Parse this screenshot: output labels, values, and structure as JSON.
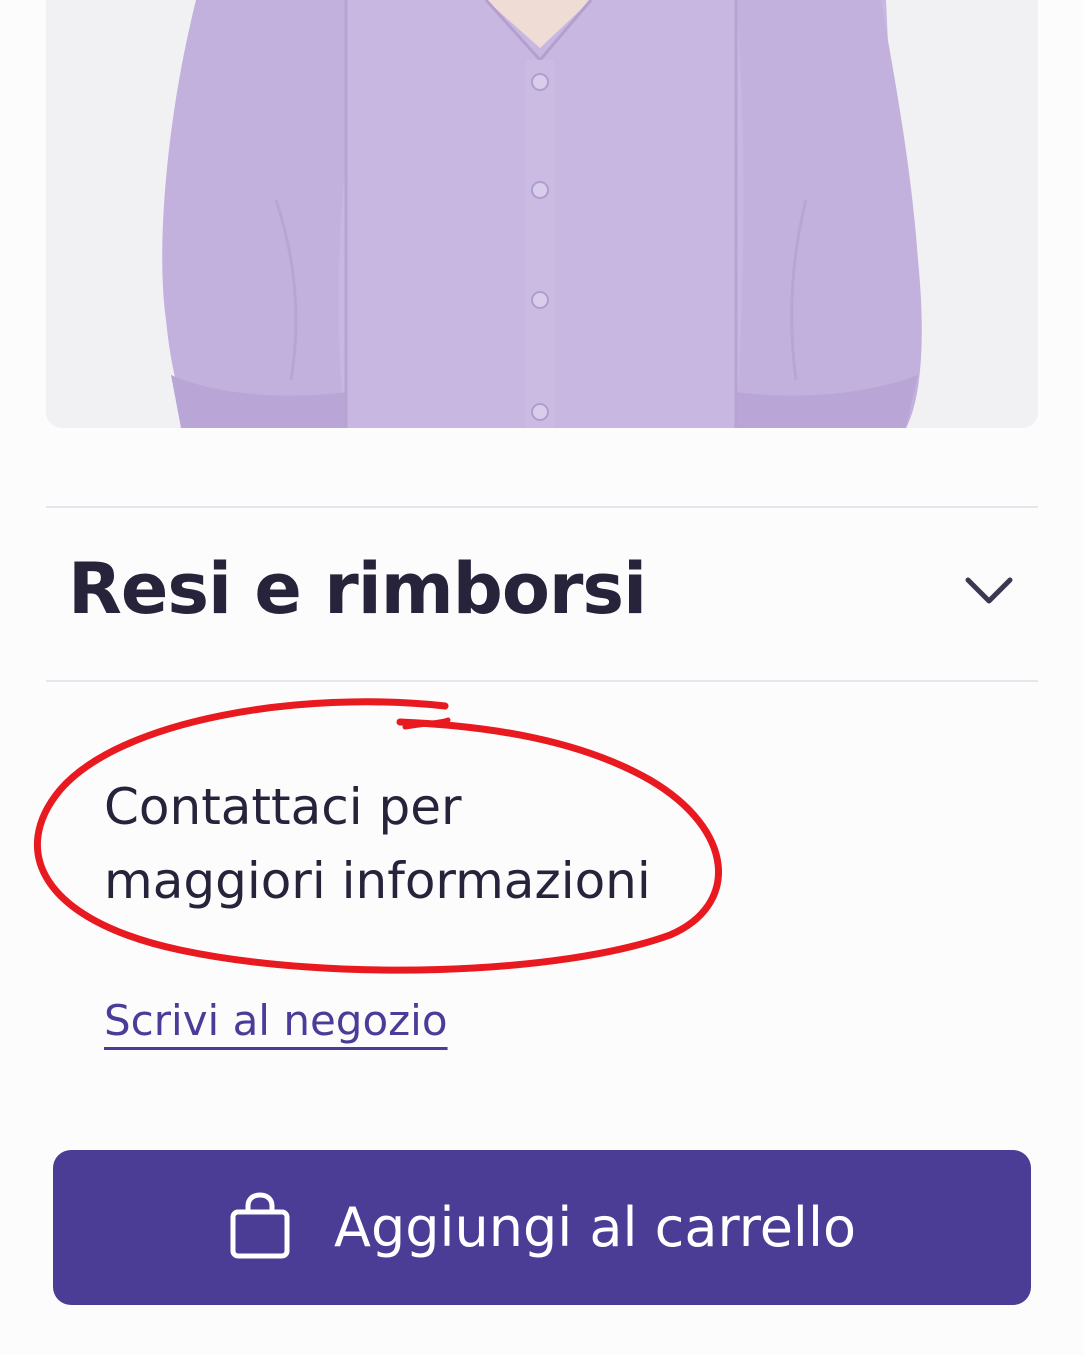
{
  "product": {
    "image_subject": "lilac-blouse"
  },
  "accordion": {
    "title": "Resi e rimborsi",
    "state": "collapsed",
    "icon": "chevron-down-icon"
  },
  "contact": {
    "line1": "Contattaci per",
    "line2": "maggiori informazioni",
    "link_label": "Scrivi al negozio"
  },
  "cart_button": {
    "label": "Aggiungi al carrello",
    "icon": "shopping-bag-icon"
  },
  "colors": {
    "accent": "#4b3c96",
    "link": "#4a3c98",
    "highlight": "#e8191f",
    "text": "#26233a"
  }
}
